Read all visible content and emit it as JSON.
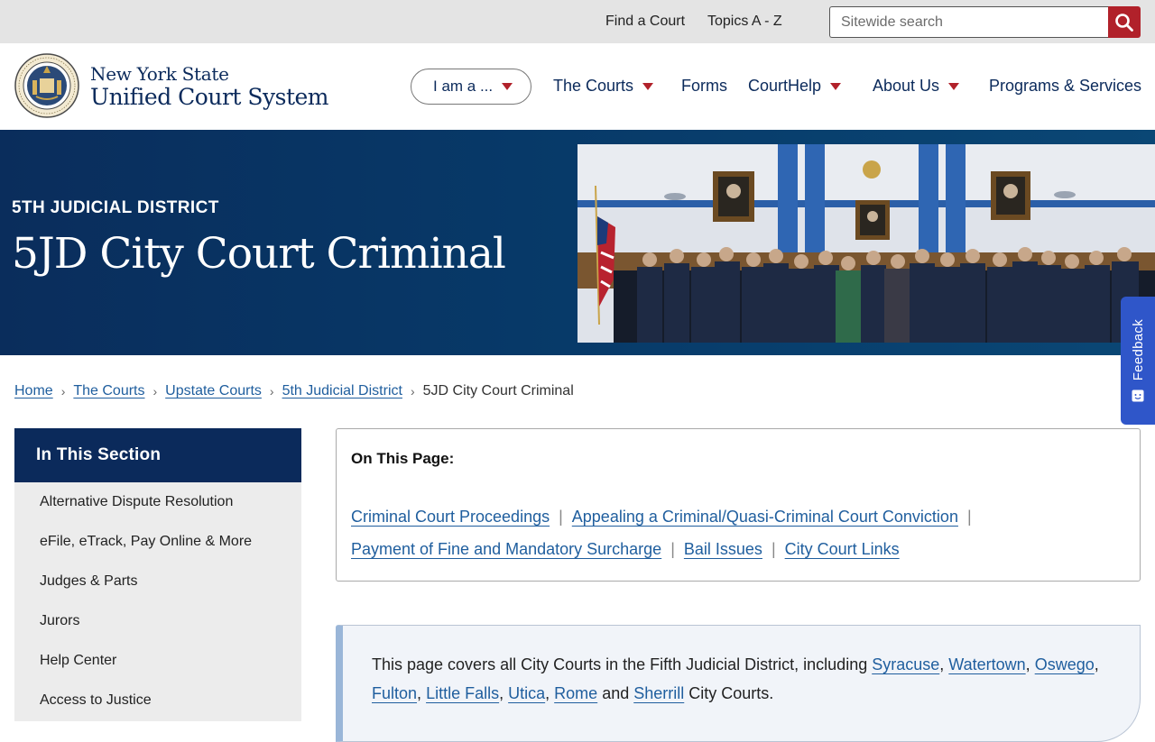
{
  "utility": {
    "find_court": "Find a Court",
    "topics": "Topics A - Z",
    "search_placeholder": "Sitewide search"
  },
  "brand": {
    "line1": "New York State",
    "line2": "Unified Court System",
    "seal_top_text": "NEW YORK STATE",
    "seal_bottom_text": "UNIFIED COURT SYSTEM"
  },
  "nav": {
    "iam": "I am a ...",
    "courts": "The Courts",
    "forms": "Forms",
    "courthelp": "CourtHelp",
    "about": "About Us",
    "programs": "Programs & Services"
  },
  "hero": {
    "eyebrow": "5TH JUDICIAL DISTRICT",
    "title": "5JD City Court Criminal"
  },
  "breadcrumb": {
    "items": [
      "Home",
      "The Courts",
      "Upstate Courts",
      "5th Judicial District"
    ],
    "current": "5JD City Court Criminal"
  },
  "feedback": "Feedback",
  "sidebar": {
    "title": "In This Section",
    "items": [
      "Alternative Dispute Resolution",
      "eFile, eTrack, Pay Online & More",
      "Judges & Parts",
      "Jurors",
      "Help Center",
      "Access to Justice"
    ]
  },
  "on_this_page": {
    "title": "On This Page:",
    "links": [
      "Criminal Court Proceedings",
      "Appealing a Criminal/Quasi-Criminal Court Conviction",
      "Payment of Fine and Mandatory Surcharge",
      "Bail Issues",
      "City Court Links"
    ],
    "separator": "|"
  },
  "callout": {
    "intro": "This page covers all City Courts in the Fifth Judicial District, including ",
    "cities": [
      "Syracuse",
      "Watertown",
      "Oswego",
      "Fulton",
      "Little Falls",
      "Utica",
      "Rome",
      "Sherrill"
    ],
    "comma": ",",
    "and": " and ",
    "outro": " City Courts."
  },
  "colors": {
    "navy": "#0b2a5b",
    "accent_red": "#b1212a",
    "link": "#1f5e9e",
    "feedback": "#2f56c9"
  }
}
